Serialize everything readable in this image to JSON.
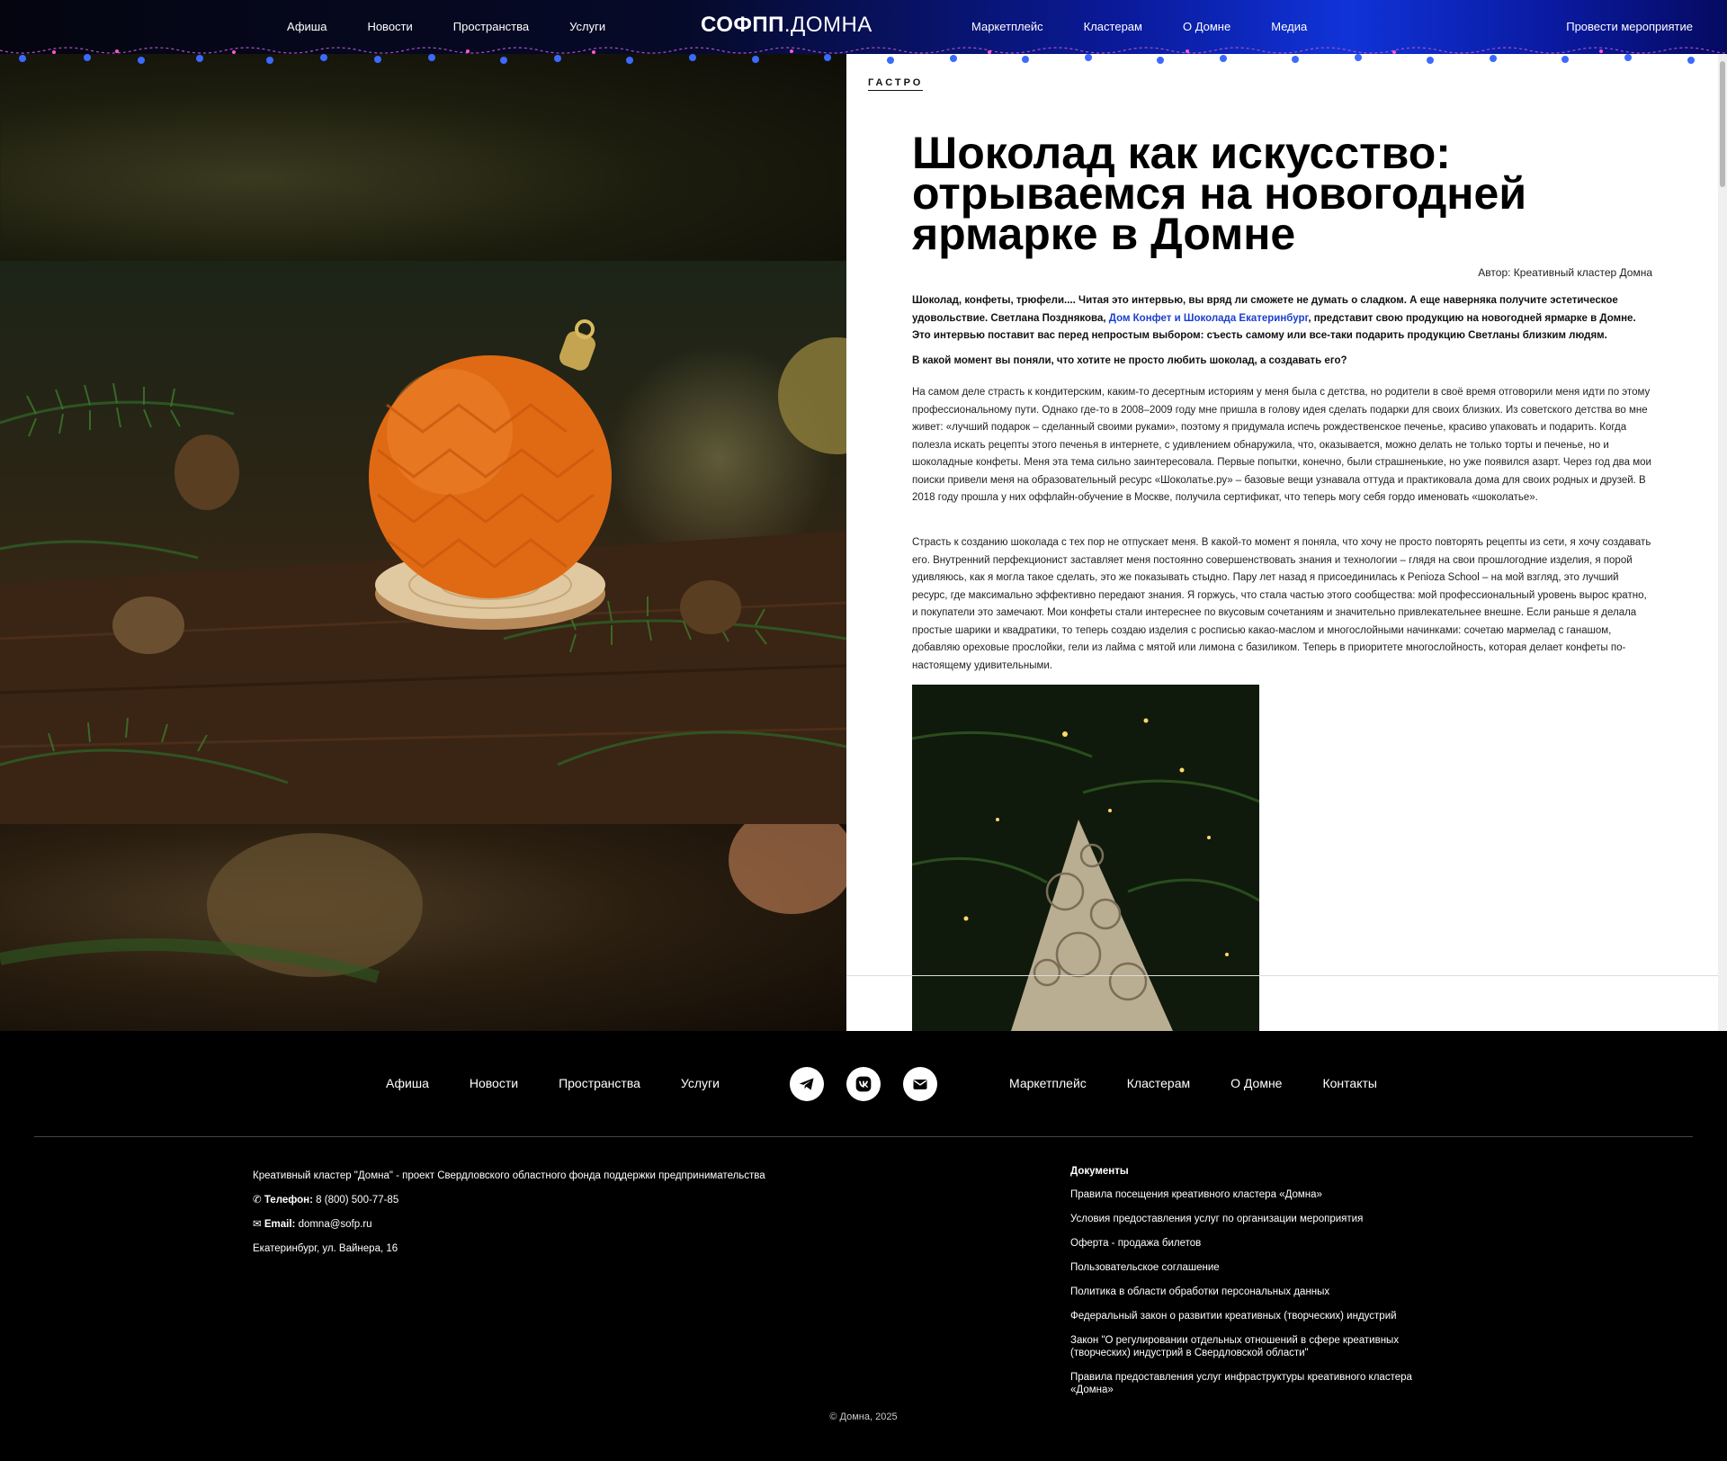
{
  "header": {
    "nav_left": [
      "Афиша",
      "Новости",
      "Пространства",
      "Услуги"
    ],
    "logo_bold": "СОФПП",
    "logo_rest": ".ДОМНА",
    "nav_right": [
      "Маркетплейс",
      "Кластерам",
      "О Домне",
      "Медиа"
    ],
    "cta": "Провести мероприятие",
    "accent": "#1033d8"
  },
  "article": {
    "category": "ГАСТРО",
    "title": "Шоколад как искусство: отрываемся на новогодней ярмарке в Домне",
    "author": "Автор: Креативный кластер Домна",
    "lead_before": "Шоколад, конфеты, трюфели.... Читая это интервью, вы вряд ли сможете не думать о сладком. А еще наверняка получите эстетическое удовольствие. Светлана Позднякова, ",
    "lead_link": "Дом Конфет и Шоколада Екатеринбург",
    "lead_after": ", представит свою продукцию на новогодней ярмарке в Домне. Это интервью поставит вас перед непростым выбором: съесть самому или все-таки подарить продукцию Светланы близким людям.",
    "question": "В какой момент вы поняли, что хотите не просто любить шоколад, а создавать его?",
    "paragraph1": "На самом деле страсть к кондитерским, каким-то десертным историям у меня была с детства, но родители в своё время отговорили меня идти по этому профессиональному пути. Однако где-то в 2008–2009 году мне пришла в голову идея сделать подарки для своих близких. Из советского детства во мне живет: «лучший подарок – сделанный своими руками», поэтому я придумала испечь рождественское печенье, красиво упаковать и подарить. Когда полезла искать рецепты этого печенья в интернете, с удивлением обнаружила, что, оказывается, можно делать не только торты и печенье, но и шоколадные конфеты. Меня эта тема сильно заинтересовала. Первые попытки, конечно, были страшненькие, но уже появился азарт. Через год два мои поиски привели меня на  образовательный ресурс «Шоколатье.ру» – базовые вещи узнавала оттуда и практиковала дома для своих родных и друзей. В 2018 году прошла у них оффлайн-обучение в Москве, получила сертификат, что теперь могу себя гордо именовать «шоколатье».",
    "paragraph2": "Страсть к созданию шоколада с тех пор не отпускает меня. В какой-то момент я поняла, что хочу не просто повторять рецепты из сети, я хочу создавать его. Внутренний перфекционист заставляет меня постоянно совершенствовать знания и технологии – глядя на свои прошлогодние изделия, я порой удивляюсь, как я могла такое сделать, это же показывать стыдно. Пару лет назад я присоединилась к Penioza School – на мой взгляд, это лучший ресурс, где максимально эффективно передают знания. Я горжусь, что стала частью этого сообщества: мой профессиональный уровень вырос кратно, и покупатели это замечают. Мои конфеты стали интереснее по вкусовым сочетаниям и значительно привлекательнее внешне. Если раньше я делала простые шарики и квадратики, то теперь создаю изделия с росписью какао-маслом и многослойными начинками: сочетаю мармелад с ганашом, добавляю ореховые прослойки, гели из лайма с мятой или лимона с базиликом. Теперь в приоритете многослойность, которая делает конфеты по-настоящему удивительными."
  },
  "footer": {
    "nav_left": [
      "Афиша",
      "Новости",
      "Пространства",
      "Услуги"
    ],
    "nav_right": [
      "Маркетплейс",
      "Кластерам",
      "О Домне",
      "Контакты"
    ],
    "social": [
      "telegram-icon",
      "vk-icon",
      "mail-icon"
    ],
    "org": "Креативный кластер \"Домна\" - проект Свердловского областного фонда поддержки предпринимательства",
    "phone_label": "Телефон:",
    "phone": "8 (800) 500-77-85",
    "email_label": "Email:",
    "email": "domna@sofp.ru",
    "address": "Екатеринбург, ул. Вайнера, 16",
    "docs_title": "Документы",
    "docs": [
      "Правила посещения креативного кластера «Домна»",
      "Условия предоставления услуг по организации мероприятия",
      "Оферта - продажа билетов",
      "Пользовательское соглашение",
      "Политика в области обработки персональных данных",
      "Федеральный закон о развитии креативных (творческих) индустрий",
      "Закон \"О регулировании отдельных отношений в сфере креативных (творческих) индустрий в Свердловской области\"",
      "Правила предоставления услуг инфраструктуры креативного кластера «Домна»"
    ],
    "copyright": "© Домна, 2025"
  }
}
